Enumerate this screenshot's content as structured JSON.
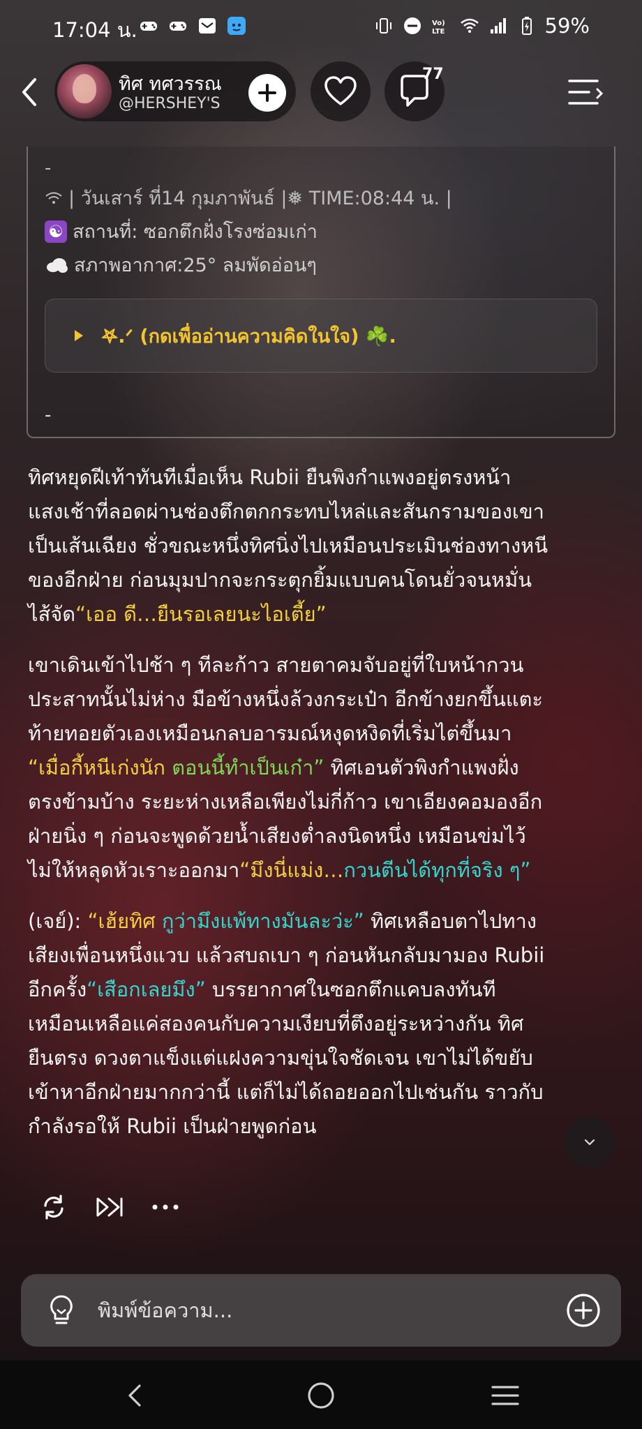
{
  "status_bar": {
    "time": "17:04 น.",
    "battery": "59%"
  },
  "header": {
    "name": "ทิศ ทศวรรณ",
    "handle": "@HERSHEY'S",
    "comment_count": "77"
  },
  "info_card": {
    "top_dash": "-",
    "date_line": "| วันเสาร์ ที่14 กุมภาพันธ์ |❅ TIME:08:44 น. |",
    "place_emoji": "☯",
    "place_line": "สถานที่: ซอกตึกฝั่งโรงซ่อมเก่า",
    "weather_line": "สภาพอากาศ:25° ลมพัดอ่อนๆ",
    "thought_label": "𖤐.ᐟ (กดเพื่ออ่านความคิดในใจ) ☘️.",
    "bottom_dash": "-"
  },
  "story": {
    "p1": {
      "l1": "ทิศหยุดฝีเท้าทันทีเมื่อเห็น Rubii ยืนพิงกำแพงอยู่ตรงหน้า",
      "l2": "แสงเช้าที่ลอดผ่านช่องตึกตกกระทบไหล่และสันกรามของเขา",
      "l3": "เป็นเส้นเฉียง ชั่วขณะหนึ่งทิศนิ่งไปเหมือนประเมินช่องทางหนี",
      "l4": "ของอีกฝ่าย ก่อนมุมปากจะกระตุกยิ้มแบบคนโดนยั่วจนหมั่น",
      "l5a": "ไส้จัด",
      "l5q1": "“เออ ดี…",
      "l5q2": "ยืนรอเลยนะไอเตี้ย”"
    },
    "p2": {
      "l1": "เขาเดินเข้าไปช้า ๆ ทีละก้าว สายตาคมจับอยู่ที่ใบหน้ากวน",
      "l2": "ประสาทนั้นไม่ห่าง มือข้างหนึ่งล้วงกระเป๋า อีกข้างยกขึ้นแตะ",
      "l3": "ท้ายทอยตัวเองเหมือนกลบอารมณ์หงุดหงิดที่เริ่มไต่ขึ้นมา",
      "l4q1": "“เมื่อกี้หนีเก่งนัก ",
      "l4q2": "ตอนนี้ทำเป็นเก๋า”",
      "l4b": " ทิศเอนตัวพิงกำแพงฝั่ง",
      "l5": "ตรงข้ามบ้าง ระยะห่างเหลือเพียงไม่กี่ก้าว เขาเอียงคอมองอีก",
      "l6": "ฝ่ายนิ่ง ๆ ก่อนจะพูดด้วยน้ำเสียงต่ำลงนิดหนึ่ง เหมือนข่มไว้",
      "l7a": "ไม่ให้หลุดหัวเราะออกมา",
      "l7q1": "“มึงนี่แม่ง…",
      "l7q2": "กวนตีนได้ทุกที่จริง ๆ”"
    },
    "p3": {
      "l1a": "(เจย์): ",
      "l1q1": "“เฮ้ยทิศ ",
      "l1q2": "กูว่ามึงแพ้ทางมันละว่ะ”",
      "l1b": " ทิศเหลือบตาไปทาง",
      "l2": "เสียงเพื่อนหนึ่งแวบ แล้วสบถเบา ๆ ก่อนหันกลับมามอง Rubii",
      "l3a": "อีกครั้ง",
      "l3q": "“เสือกเลยมึง”",
      "l3b": " บรรยากาศในซอกตึกแคบลงทันที",
      "l4": "เหมือนเหลือแค่สองคนกับความเงียบที่ตึงอยู่ระหว่างกัน ทิศ",
      "l5": "ยืนตรง ดวงตาแข็งแต่แฝงความขุ่นใจชัดเจน เขาไม่ได้ขยับ",
      "l6": "เข้าหาอีกฝ่ายมากกว่านี้ แต่ก็ไม่ได้ถอยออกไปเช่นกัน ราวกับ",
      "l7": "กำลังรอให้ Rubii เป็นฝ่ายพูดก่อน"
    }
  },
  "composer": {
    "placeholder": "พิมพ์ข้อความ..."
  },
  "colors": {
    "quote_yellow": "#f3d03e",
    "quote_cyan": "#35d6d0",
    "quote_green": "#7ed957",
    "thought_gold": "#f4c430"
  }
}
